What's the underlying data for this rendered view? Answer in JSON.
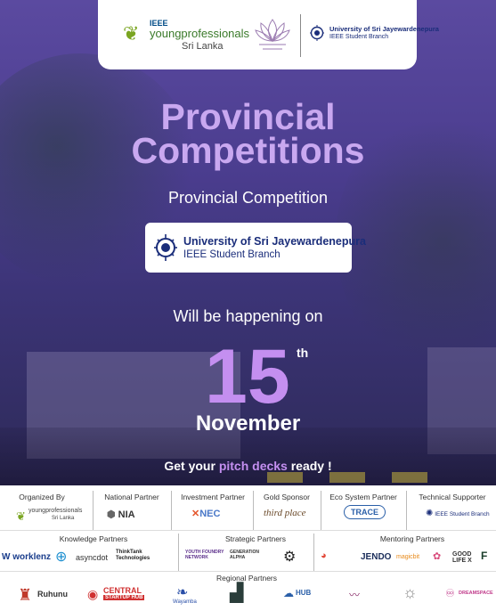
{
  "header": {
    "ieee_line1": "IEEE",
    "ieee_line2": "youngprofessionals",
    "ieee_line3": "Sri Lanka",
    "usj_line1": "University of Sri Jayewardenepura",
    "usj_line2": "IEEE Student Branch"
  },
  "hero": {
    "title_line1": "Provincial",
    "title_line2": "Competitions",
    "subtitle": "Provincial Competition",
    "card_line1": "University of Sri Jayewardenepura",
    "card_line2": "IEEE Student Branch",
    "happening": "Will be happening on",
    "day": "15",
    "day_suffix": "th",
    "month": "November",
    "pitch_prefix": "Get your ",
    "pitch_highlight": "pitch decks",
    "pitch_suffix": " ready !"
  },
  "partners": {
    "organized_by": "Organized By",
    "national_partner": "National Partner",
    "investment_partner": "Investment Partner",
    "gold_sponsor": "Gold Sponsor",
    "ecosystem_partner": "Eco System Partner",
    "technical_supporter": "Technical Supporter",
    "knowledge_partners": "Knowledge Partners",
    "strategic_partners": "Strategic Partners",
    "mentoring_partners": "Mentoring Partners",
    "regional_partners": "Regional Partners",
    "logos": {
      "org_ieee": "youngprofessionals",
      "org_ieee_sub": "Sri Lanka",
      "nia": "NIA",
      "nec": "NEC",
      "thirdplace": "third place",
      "trace": "TRACE",
      "tech_usj": "IEEE Student Branch",
      "worklenz": "worklenz",
      "asyncdot": "asyncdot",
      "thinktank": "ThinkTank Technologies",
      "youth_foundry": "YOUTH FOUNDRY NETWORK",
      "generation_alpha": "GENERATION ALPHA",
      "jendo": "JENDO",
      "magicbit": "magicbit",
      "goodlife": "GOOD LIFE X",
      "ruhunu": "Ruhunu",
      "central": "CENTRAL",
      "central_sub": "STARTUP HUB",
      "wayamba": "Wayamba",
      "ujhub": "HUB",
      "dreamspace": "DREAMSPACE"
    }
  },
  "colors": {
    "title": "#c9a8f0",
    "accent": "#c48ff0",
    "usj_blue": "#1a2d7a"
  }
}
